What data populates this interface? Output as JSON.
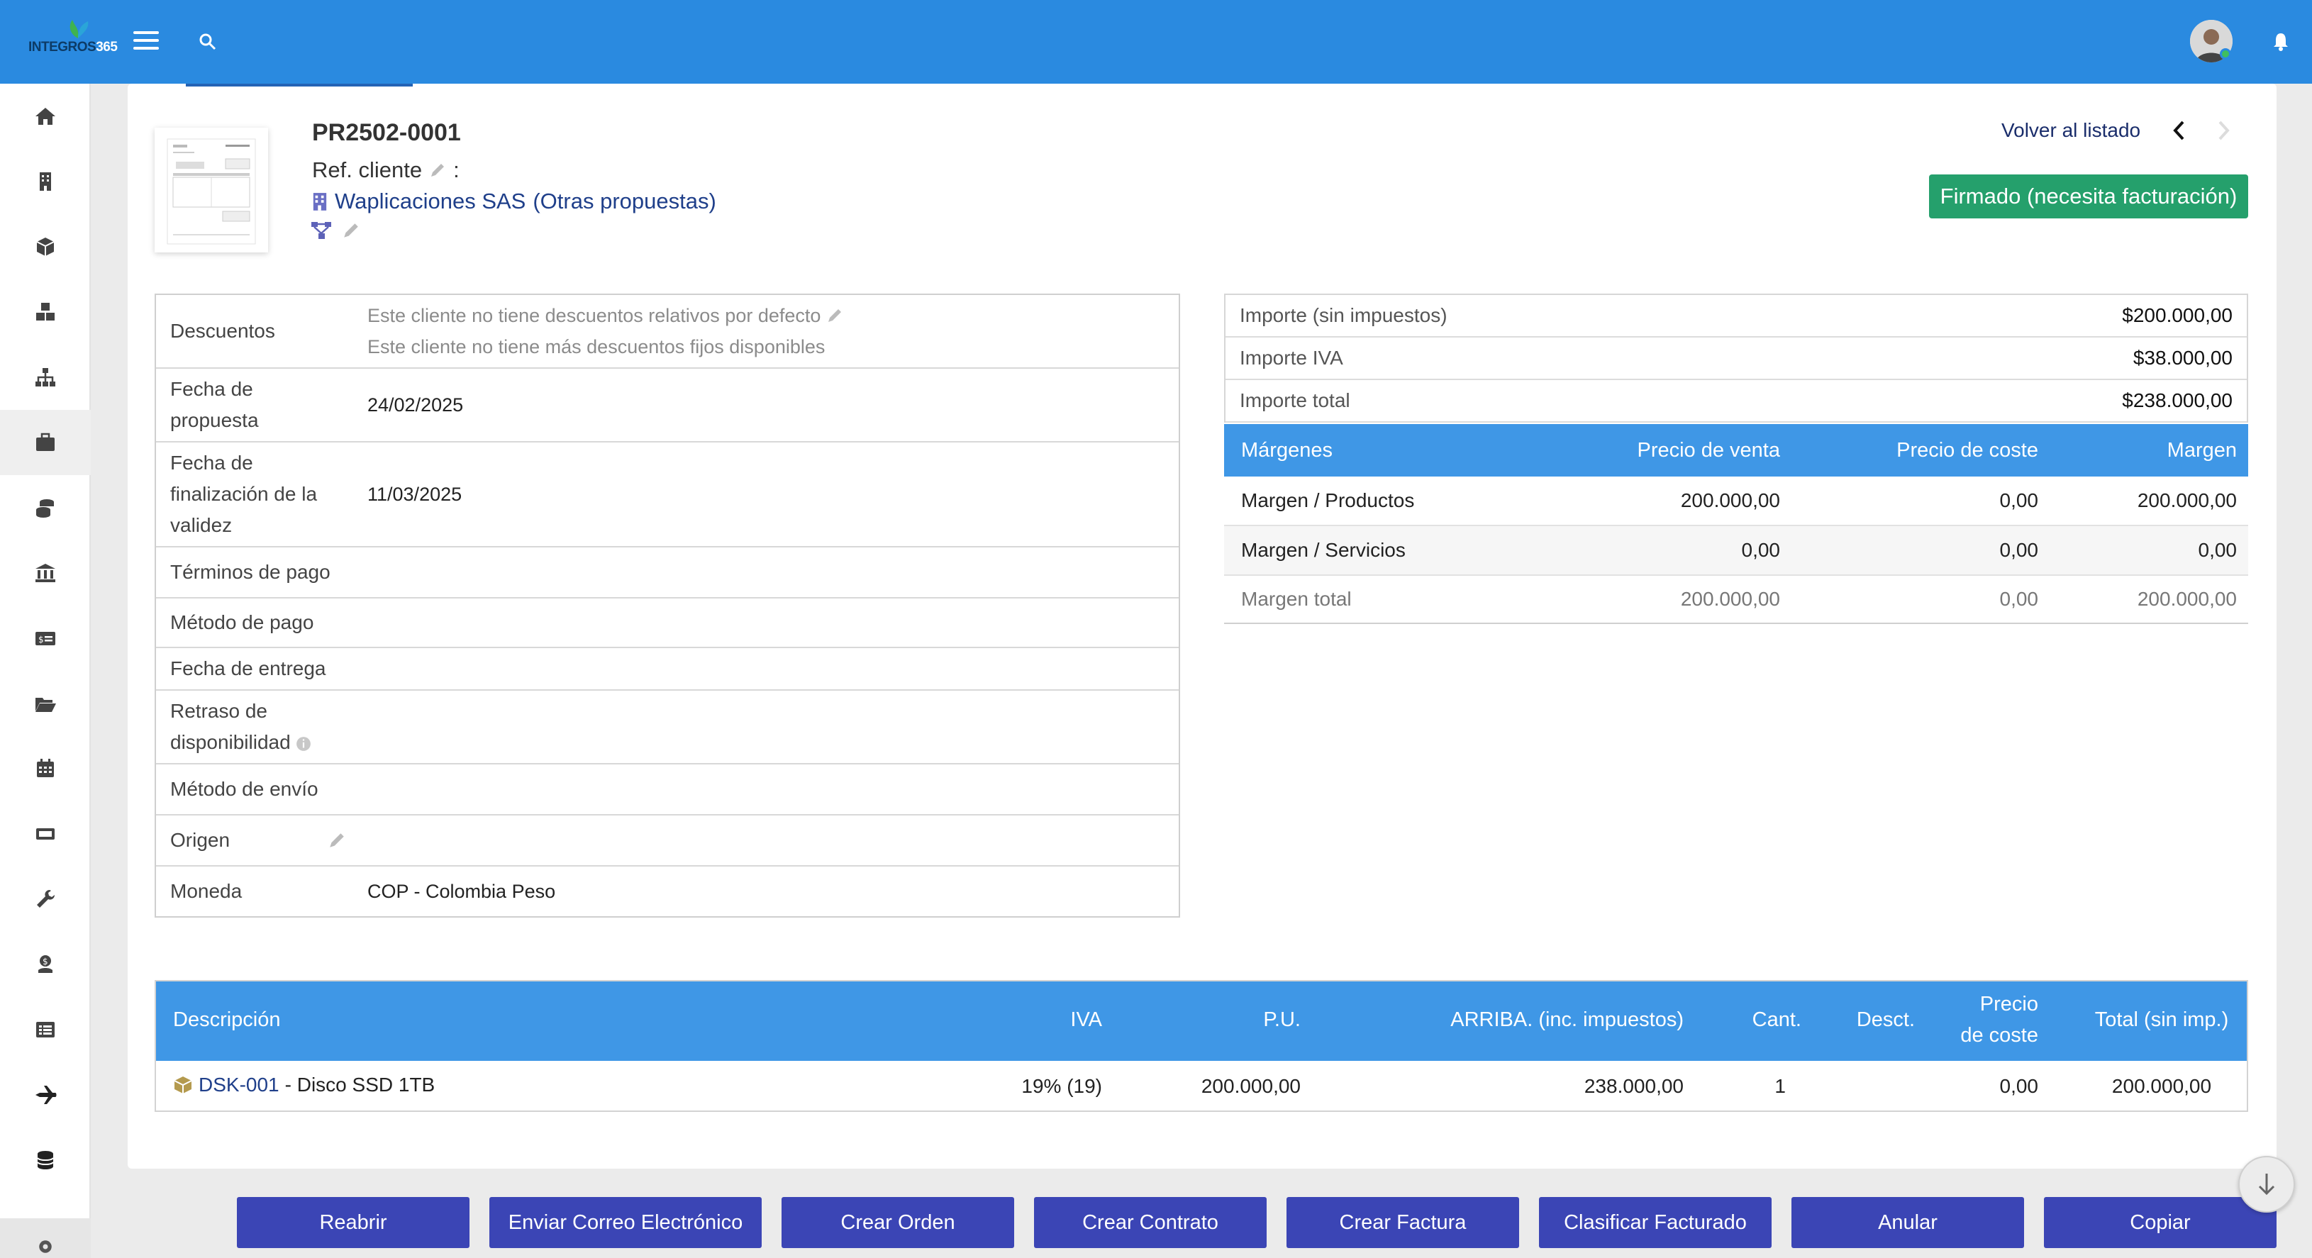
{
  "brand": {
    "logo_text_a": "INTEGROS",
    "logo_text_b": "365"
  },
  "colors": {
    "topbar": "#2a8ae0",
    "primary_button": "#3b45b5",
    "status": "#25a06c",
    "table_header": "#3f97e6",
    "link": "#1f3f8a"
  },
  "sidebar": {
    "items": [
      {
        "icon": "home-icon"
      },
      {
        "icon": "building-icon"
      },
      {
        "icon": "cube-icon"
      },
      {
        "icon": "cubes-icon"
      },
      {
        "icon": "sitemap-icon"
      },
      {
        "icon": "briefcase-icon"
      },
      {
        "icon": "coins-icon"
      },
      {
        "icon": "bank-icon"
      },
      {
        "icon": "money-check-icon"
      },
      {
        "icon": "folder-open-icon"
      },
      {
        "icon": "calendar-icon"
      },
      {
        "icon": "ticket-icon"
      },
      {
        "icon": "wrench-icon"
      },
      {
        "icon": "hand-holding-icon"
      },
      {
        "icon": "list-alt-icon"
      },
      {
        "icon": "plane-icon"
      },
      {
        "icon": "database-icon"
      },
      {
        "icon": "gear-icon"
      }
    ]
  },
  "header": {
    "ref": "PR2502-0001",
    "ref_client_label": "Ref. cliente",
    "ref_client_sep": ":",
    "company": "Waplicaciones SAS",
    "company_suffix": "(Otras propuestas)",
    "back_link": "Volver al listado",
    "status": "Firmado (necesita facturación)"
  },
  "info": {
    "discounts_label": "Descuentos",
    "discounts_line1": "Este cliente no tiene descuentos relativos por defecto",
    "discounts_line2": "Este cliente no tiene más descuentos fijos disponibles",
    "date_label": "Fecha de propuesta",
    "date_value": "24/02/2025",
    "validity_label": "Fecha de finalización de la validez",
    "validity_value": "11/03/2025",
    "payment_terms_label": "Términos de pago",
    "payment_method_label": "Método de pago",
    "delivery_date_label": "Fecha de entrega",
    "availability_label": "Retraso de disponibilidad",
    "shipping_label": "Método de envío",
    "origin_label": "Origen",
    "currency_label": "Moneda",
    "currency_value": "COP - Colombia Peso"
  },
  "totals": {
    "net_label": "Importe (sin impuestos)",
    "net_value": "$200.000,00",
    "vat_label": "Importe IVA",
    "vat_value": "$38.000,00",
    "total_label": "Importe total",
    "total_value": "$238.000,00"
  },
  "margins": {
    "headers": [
      "Márgenes",
      "Precio de venta",
      "Precio de coste",
      "Margen"
    ],
    "rows": [
      [
        "Margen / Productos",
        "200.000,00",
        "0,00",
        "200.000,00"
      ],
      [
        "Margen / Servicios",
        "0,00",
        "0,00",
        "0,00"
      ],
      [
        "Margen total",
        "200.000,00",
        "0,00",
        "200.000,00"
      ]
    ]
  },
  "lines": {
    "headers": {
      "desc": "Descripción",
      "vat": "IVA",
      "pu": "P.U.",
      "pu_tax": "ARRIBA. (inc. impuestos)",
      "qty": "Cant.",
      "disc": "Desct.",
      "cost_a": "Precio",
      "cost_b": "de coste",
      "total": "Total (sin imp.)"
    },
    "rows": [
      {
        "code": "DSK-001",
        "label": "- Disco SSD 1TB",
        "vat": "19% (19)",
        "pu": "200.000,00",
        "pu_tax": "238.000,00",
        "qty": "1",
        "disc": "",
        "cost": "0,00",
        "total": "200.000,00"
      }
    ]
  },
  "actions": [
    "Reabrir",
    "Enviar Correo Electrónico",
    "Crear Orden",
    "Crear Contrato",
    "Crear Factura",
    "Clasificar Facturado",
    "Anular",
    "Copiar"
  ]
}
